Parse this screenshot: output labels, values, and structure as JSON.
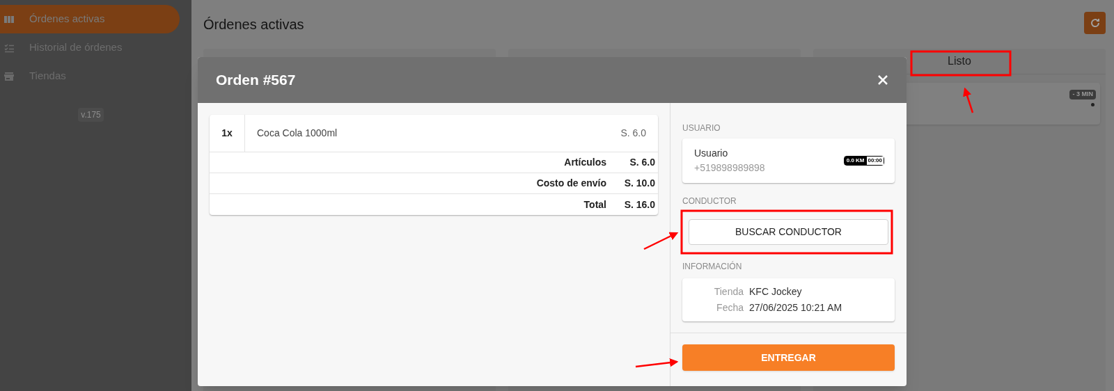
{
  "sidebar": {
    "items": [
      {
        "label": "Órdenes activas",
        "kind": "columns",
        "selected": true
      },
      {
        "label": "Historial de órdenes",
        "kind": "checklist",
        "selected": false
      },
      {
        "label": "Tiendas",
        "kind": "store",
        "selected": false
      }
    ],
    "version": "v.175"
  },
  "page": {
    "title": "Órdenes activas",
    "columns": [
      {},
      {},
      {
        "title": "Listo",
        "cards": [
          {
            "badge": "- 3 MIN"
          }
        ]
      }
    ]
  },
  "modal": {
    "title": "Orden #567",
    "items": [
      {
        "qty": "1x",
        "name": "Coca Cola 1000ml",
        "price": "S. 6.0"
      }
    ],
    "totals": [
      {
        "label": "Artículos",
        "value": "S. 6.0"
      },
      {
        "label": "Costo de envío",
        "value": "S. 10.0"
      },
      {
        "label": "Total",
        "value": "S. 16.0"
      }
    ],
    "user": {
      "label": "USUARIO",
      "name": "Usuario",
      "phone": "+519898989898",
      "distance": "0.0 KM",
      "time": "00:00"
    },
    "driver": {
      "label": "CONDUCTOR",
      "button": "BUSCAR CONDUCTOR"
    },
    "info": {
      "label": "INFORMACIÓN",
      "rows": [
        {
          "label": "Tienda",
          "value": "KFC Jockey"
        },
        {
          "label": "Fecha",
          "value": "27/06/2025 10:21 AM"
        }
      ]
    },
    "action": "ENTREGAR"
  }
}
